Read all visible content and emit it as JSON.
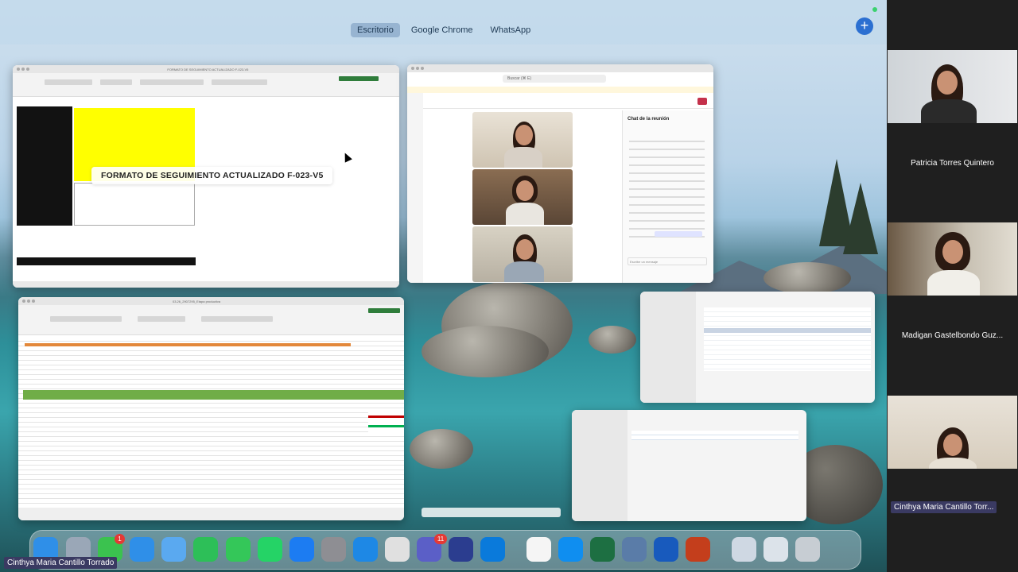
{
  "spaces": {
    "escritorio": "Escritorio",
    "chrome": "Google Chrome",
    "whatsapp": "WhatsApp"
  },
  "add_space_symbol": "+",
  "windows": {
    "excel_format": {
      "title": "FORMATO DE SEGUIMIENTO ACTUALIZADO F-023-V5"
    },
    "teams": {
      "search": "Buscar (⌘ E)",
      "chat_title": "Chat de la reunión",
      "reply_hint": "Escribe un mensaje"
    },
    "excel_planner": {
      "title": "03.26_2907295_Etapa productiva"
    }
  },
  "caption": "FORMATO DE SEGUIMIENTO ACTUALIZADO F-023-V5",
  "participants": [
    {
      "name": "Patricia Torres Quintero"
    },
    {
      "name": "Madigan Gastelbondo Guz..."
    },
    {
      "name": "Cinthya Maria Cantillo Torr..."
    }
  ],
  "presenter_label": "Cinthya Maria Cantillo Torrado",
  "dock": {
    "items": [
      "finder-icon",
      "launchpad-icon",
      "messages-icon",
      "mail-icon",
      "maps-icon",
      "facetime-icon",
      "phone-icon",
      "whatsapp-icon",
      "appstore-icon",
      "settings-icon",
      "safari-icon",
      "chrome-icon",
      "teams-icon",
      "onedrive-icon",
      "windows-app-icon",
      "notes-icon",
      "quicktime-icon",
      "excel-icon",
      "db-icon",
      "word-icon",
      "powerpoint-icon",
      "downloads-icon",
      "documents-icon",
      "trash-icon"
    ],
    "messages_badge": "1",
    "teams_badge": "11"
  },
  "colors": {
    "accent": "#2b6fd1",
    "excel_green": "#1e7145",
    "highlight_yellow": "#ffff00"
  }
}
